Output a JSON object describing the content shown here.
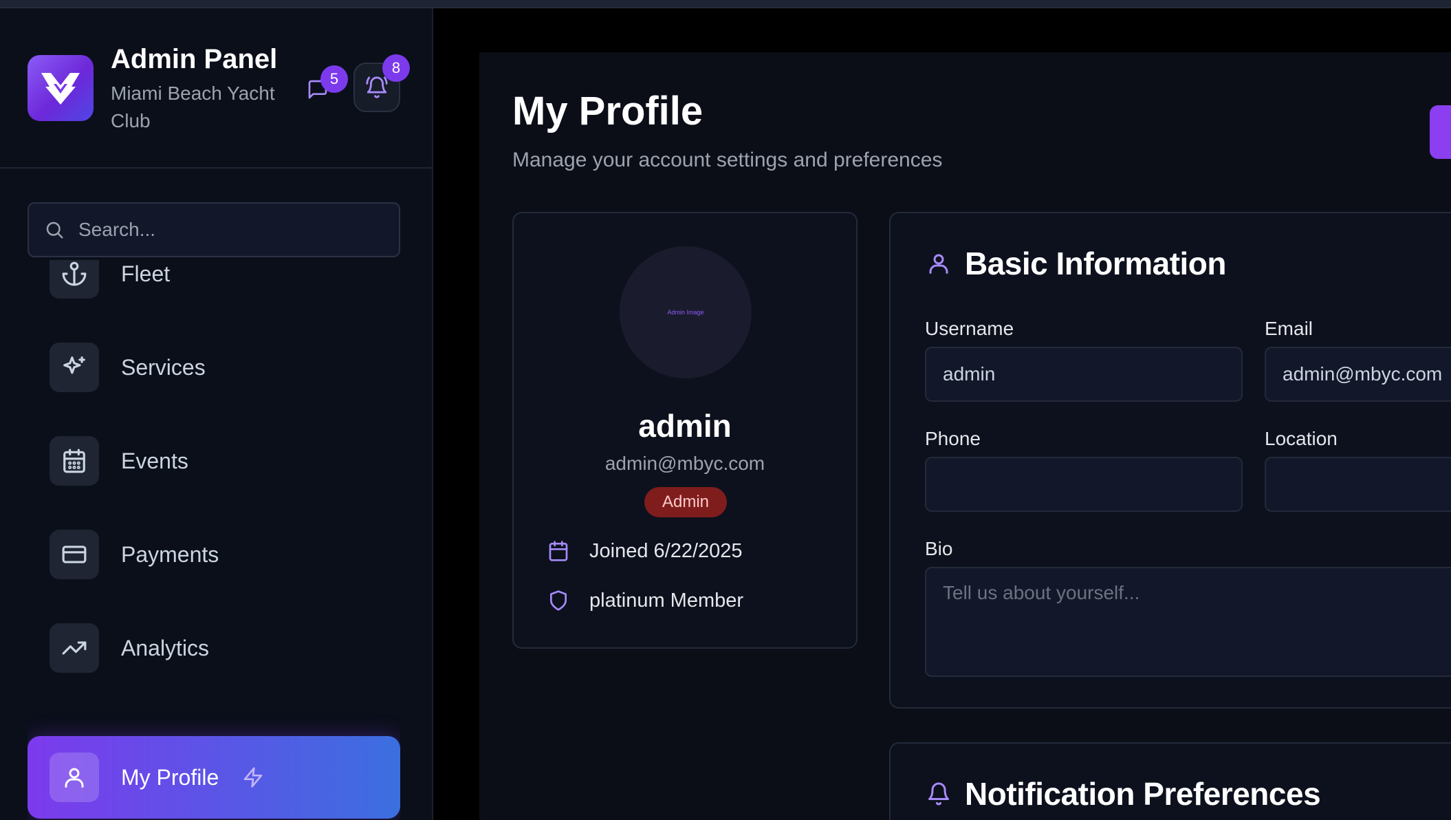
{
  "brand": {
    "title": "Admin Panel",
    "subtitle": "Miami Beach Yacht Club",
    "messages_count": "5",
    "notifications_count": "8"
  },
  "search": {
    "placeholder": "Search..."
  },
  "nav": {
    "items": [
      {
        "label": "Fleet",
        "icon": "anchor-icon"
      },
      {
        "label": "Services",
        "icon": "sparkle-icon"
      },
      {
        "label": "Events",
        "icon": "calendar-icon"
      },
      {
        "label": "Payments",
        "icon": "credit-card-icon"
      },
      {
        "label": "Analytics",
        "icon": "trending-up-icon"
      },
      {
        "label": "My Profile",
        "icon": "user-icon",
        "active": true
      }
    ]
  },
  "page": {
    "title": "My Profile",
    "subtitle": "Manage your account settings and preferences"
  },
  "profile": {
    "avatar_alt": "Admin Image",
    "name": "admin",
    "email": "admin@mbyc.com",
    "role": "Admin",
    "joined": "Joined 6/22/2025",
    "membership": "platinum Member"
  },
  "basic_info": {
    "title": "Basic Information",
    "username_label": "Username",
    "username_value": "admin",
    "email_label": "Email",
    "email_value": "admin@mbyc.com",
    "phone_label": "Phone",
    "phone_value": "",
    "location_label": "Location",
    "location_value": "",
    "bio_label": "Bio",
    "bio_placeholder": "Tell us about yourself..."
  },
  "notifications": {
    "title": "Notification Preferences"
  },
  "colors": {
    "accent": "#7c3aed",
    "accent_blue": "#3b6fe0",
    "danger_badge": "#7f1d1d"
  }
}
